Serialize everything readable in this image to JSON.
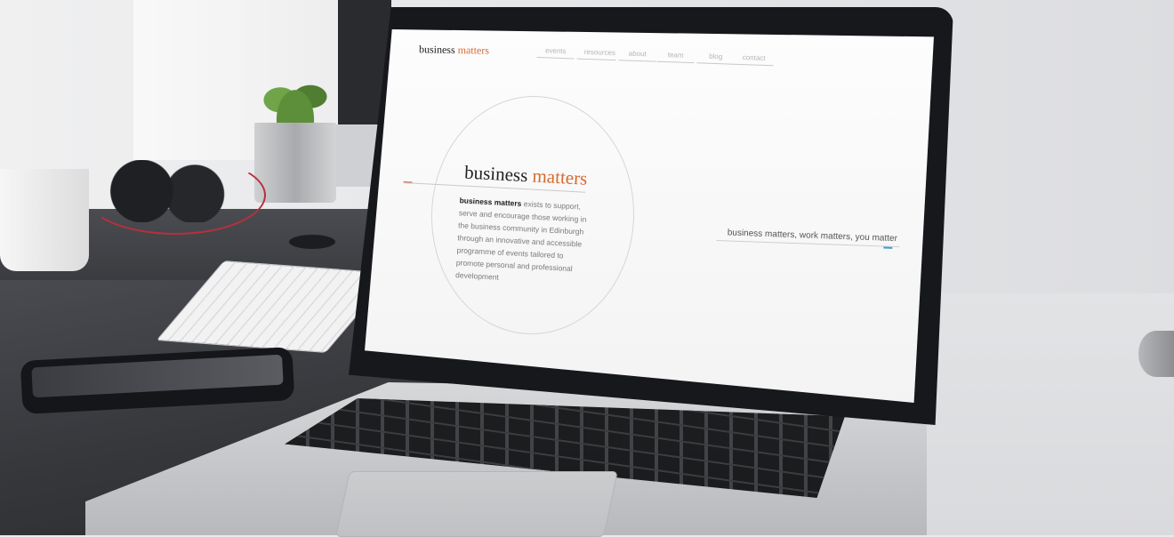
{
  "site": {
    "logo": {
      "brand": "business",
      "accent": "matters"
    },
    "nav": [
      {
        "label": "events"
      },
      {
        "label": "resources"
      },
      {
        "label": "about"
      },
      {
        "label": "team"
      },
      {
        "label": "blog"
      },
      {
        "label": "contact"
      }
    ],
    "hero": {
      "title_main": "business",
      "title_accent": "matters",
      "body_bold": "business matters",
      "body_text": " exists to support, serve and encourage those working in the business community in Edinburgh through an innovative and accessible programme of events tailored to promote personal and professional development"
    },
    "tagline": "business matters, work matters, you matter"
  },
  "colors": {
    "accent_orange": "#d9692e",
    "accent_blue": "#3aa0d0",
    "text_dark": "#222222",
    "nav_grey": "#b5b5b5"
  }
}
